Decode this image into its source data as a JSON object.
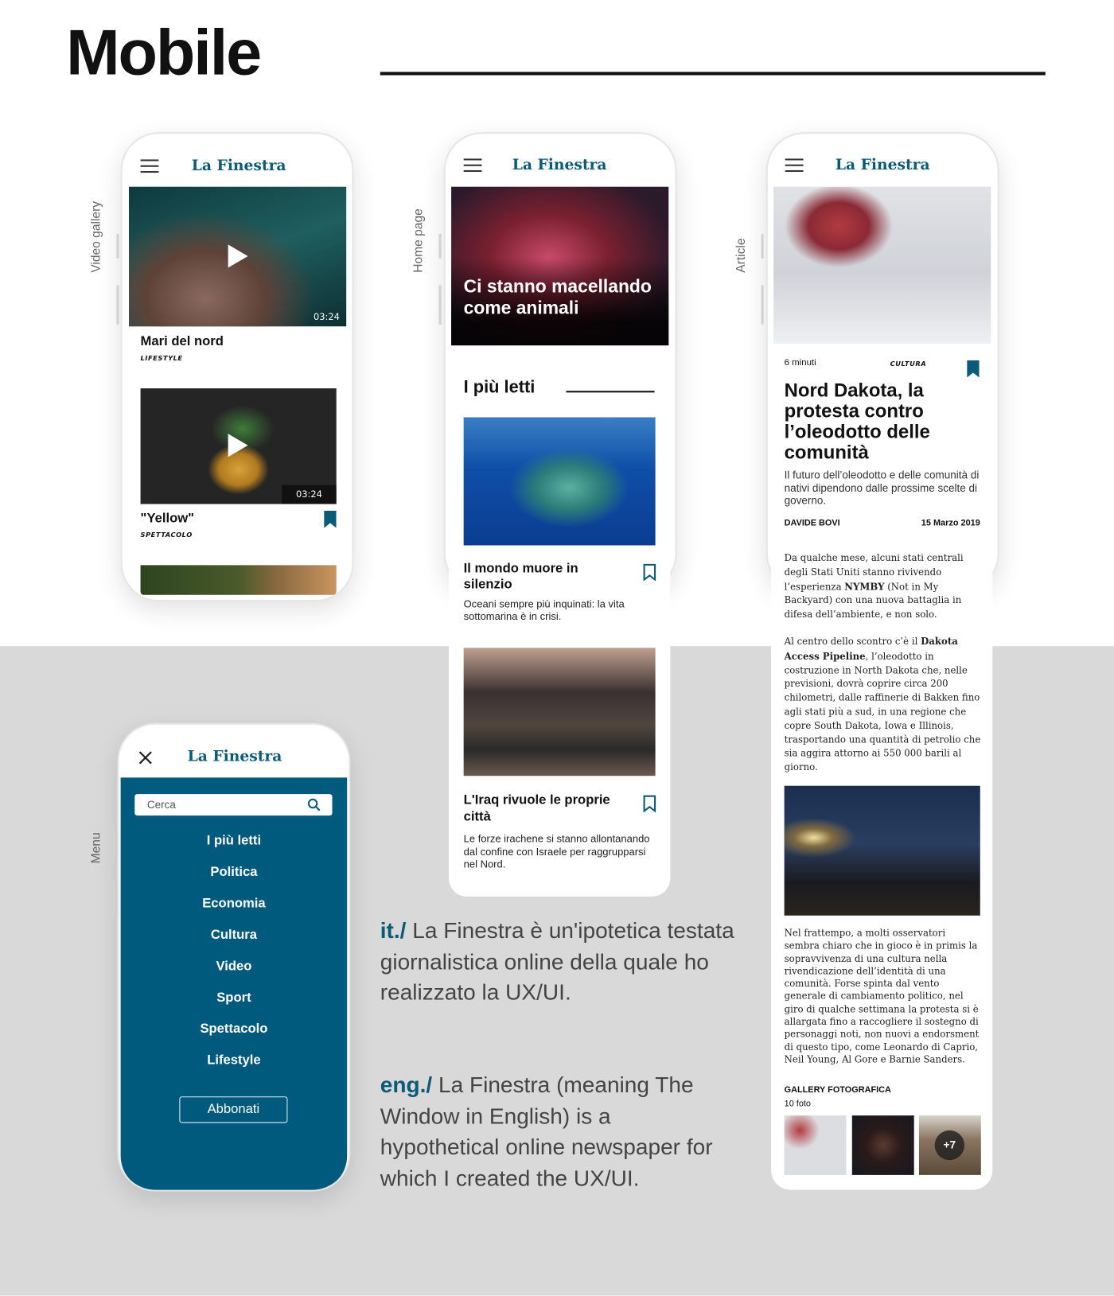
{
  "page_title": "Mobile",
  "brand": {
    "logo": "La Finestra",
    "accent": "#0b5a78",
    "background_lower": "#d9d9d9"
  },
  "screens": {
    "video_gallery": {
      "side_label": "Video gallery",
      "videos": [
        {
          "title": "Mari del nord",
          "category": "LIFESTYLE",
          "duration": "03:24"
        },
        {
          "title": "\"Yellow\"",
          "category": "SPETTACOLO",
          "duration": "03:24",
          "bookmarked": true
        }
      ]
    },
    "home": {
      "side_label": "Home page",
      "hero_title": "Ci stanno macellando come animali",
      "section_title": "I più letti",
      "articles": [
        {
          "title": "Il mondo muore in silenzio",
          "summary": "Oceani sempre più inquinati: la vita sottomarina è in crisi."
        },
        {
          "title": "L'Iraq rivuole le proprie città",
          "summary": "Le forze irachene si stanno allontanando dal confine con Israele per raggrupparsi nel Nord."
        }
      ]
    },
    "article": {
      "side_label": "Article",
      "read_time": "6 minuti",
      "category": "CULTURA",
      "title": "Nord Dakota, la protesta contro l’oleodotto delle comunità",
      "subtitle": "Il futuro dell’oleodotto e delle comunità di nativi dipendono dalle prossime scelte di governo.",
      "author": "DAVIDE BOVI",
      "date": "15 Marzo 2019",
      "p1_a": "Da qualche mese, alcuni stati centrali degli Stati Uniti stanno rivivendo l’esperienza ",
      "p1_b": "NYMBY",
      "p1_c": " (Not in My Backyard) con una nuova battaglia in difesa dell’ambiente, e non solo.",
      "p2_a": "Al centro dello scontro c’è il ",
      "p2_b": "Dakota Access Pipeline",
      "p2_c": ", l’oleodotto in costruzione in North Dakota che, nelle previsioni, dovrà coprire circa 200 chilometri, dalle raffinerie di Bakken fino agli stati più a sud, in una regione che copre South Dakota, Iowa e Illinois, trasportando una quantità di petrolio che sia aggira attorno ai 550 000 barili al giorno.",
      "p3": "Nel frattempo, a molti osservatori sembra chiaro che in gioco è in primis la sopravvivenza di una cultura nella rivendicazione dell’identità di una comunità. Forse spinta dal vento generale di cambiamento politico, nel giro di qualche settimana la protesta si è allargata fino a raccogliere il sostegno di personaggi noti, non nuovi a endorsment di questo tipo, come Leonardo di Caprio, Neil Young, Al Gore e Barnie Sanders.",
      "gallery_title": "GALLERY FOTOGRAFICA",
      "gallery_count": "10 foto",
      "gallery_more": "+7"
    },
    "menu": {
      "side_label": "Menu",
      "search_placeholder": "Cerca",
      "items": [
        "I più letti",
        "Politica",
        "Economia",
        "Cultura",
        "Video",
        "Sport",
        "Spettacolo",
        "Lifestyle"
      ],
      "subscribe": "Abbonati"
    }
  },
  "description": {
    "it_prefix": "it./",
    "it_text": " La Finestra è un'ipotetica testata giornalistica online della quale ho realizzato la UX/UI.",
    "en_prefix": "eng./",
    "en_text": " La Finestra (meaning The Window in English) is a hypothetical online newspaper for which I created the UX/UI."
  }
}
